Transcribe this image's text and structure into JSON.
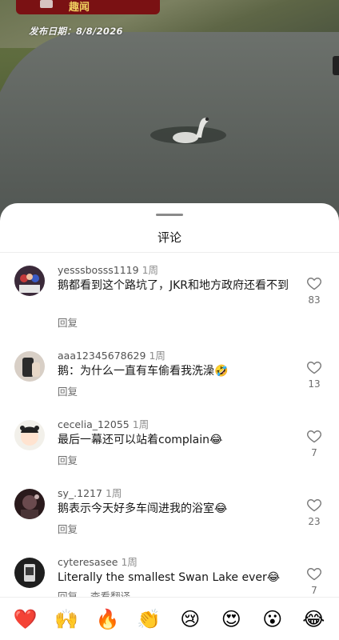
{
  "video": {
    "banner_text": "趣闻",
    "publish_date": "发布日期：8/8/2026"
  },
  "sheet": {
    "title": "评论"
  },
  "comments": [
    {
      "username": "yesssbosss1119",
      "time": "1周",
      "text": "鹅都看到这个路坑了，JKR和地方政府还看不到",
      "reply": "回复",
      "likes": "83"
    },
    {
      "username": "aaa12345678629",
      "time": "1周",
      "text": "鹅：为什么一直有车偷看我洗澡🤣",
      "reply": "回复",
      "likes": "13"
    },
    {
      "username": "cecelia_12055",
      "time": "1周",
      "text": "最后一幕还可以站着complain😂",
      "reply": "回复",
      "likes": "7"
    },
    {
      "username": "sy_.1217",
      "time": "1周",
      "text": "鹅表示今天好多车闯进我的浴室😂",
      "reply": "回复",
      "likes": "23"
    },
    {
      "username": "cyteresasee",
      "time": "1周",
      "text": "Literally the smallest Swan Lake ever😂",
      "reply": "回复",
      "translate": "查看翻译",
      "likes": "7"
    }
  ],
  "emoji_bar": [
    "❤️",
    "🙌",
    "🔥",
    "👏",
    "😢",
    "😍",
    "😮",
    "😂"
  ],
  "icons": {
    "like": "heart-outline-icon"
  },
  "colors": {
    "banner": "#7a1113",
    "banner_text": "#f0d060",
    "sheet_bg": "#ffffff"
  }
}
